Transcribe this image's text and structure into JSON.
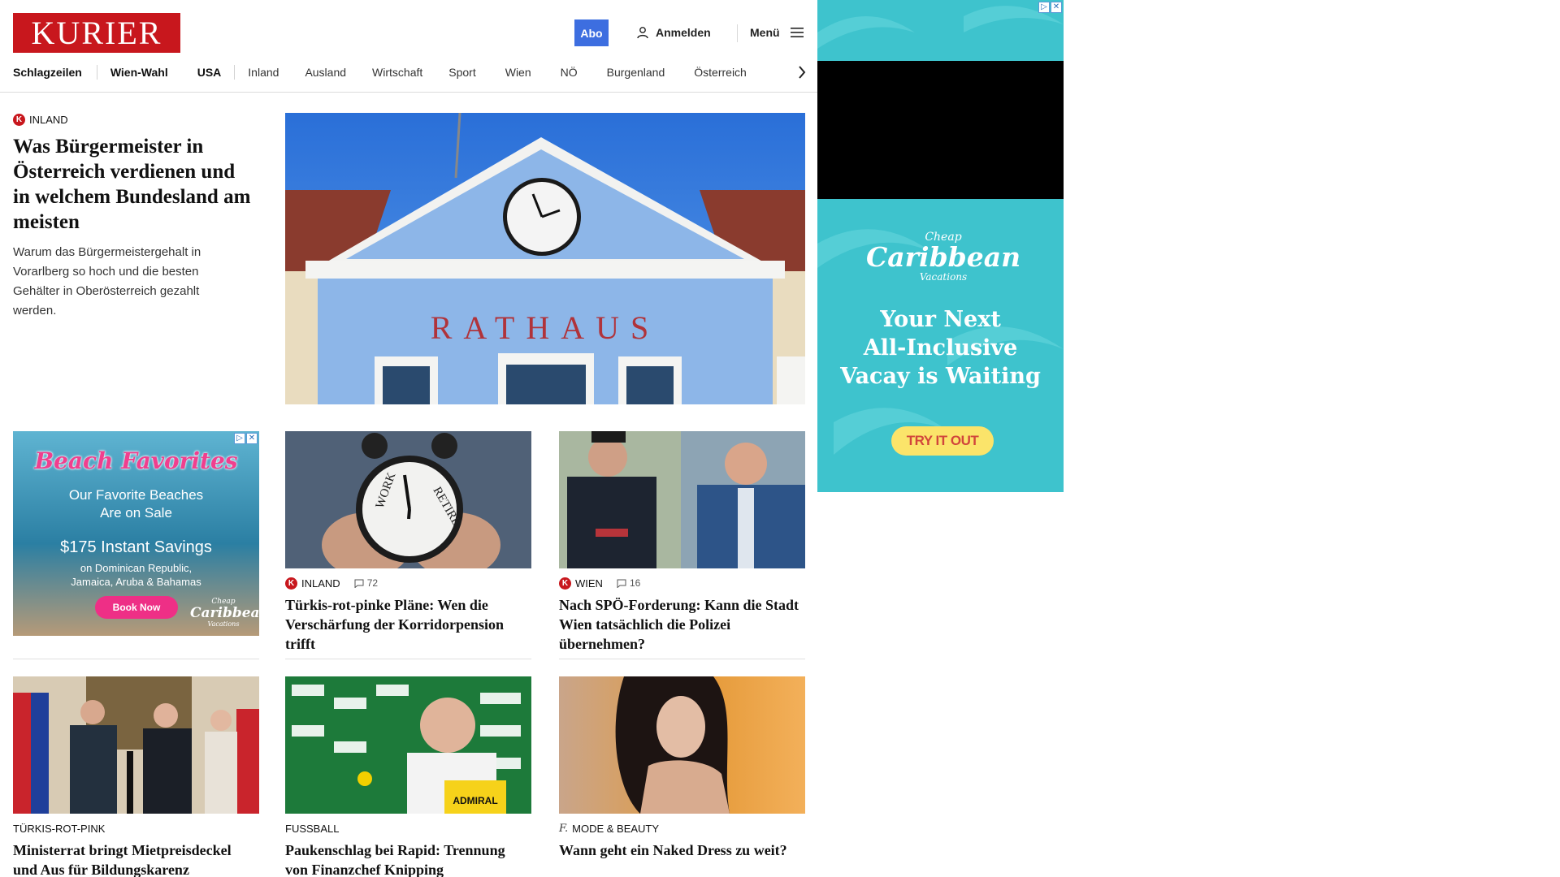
{
  "header": {
    "logo": "KURIER",
    "abo_label": "Abo",
    "login_label": "Anmelden",
    "menu_label": "Menü"
  },
  "nav": {
    "items": [
      "Schlagzeilen",
      "Wien-Wahl",
      "USA",
      "Inland",
      "Ausland",
      "Wirtschaft",
      "Sport",
      "Wien",
      "NÖ",
      "Burgenland",
      "Österreich"
    ]
  },
  "hero": {
    "kicker_badge": "K",
    "kicker": "INLAND",
    "headline": "Was Bürgermeister in Österreich verdienen und in welchem Bundesland am meisten",
    "teaser": "Warum das Bürgermeistergehalt in Vorarlberg so hoch und die besten Gehälter in Oberösterreich gezahlt werden.",
    "image_sign": "RATHAUS"
  },
  "cards": [
    {
      "kicker_badge": "K",
      "kicker": "INLAND",
      "comments": "72",
      "headline": "Türkis-rot-pinke Pläne: Wen die Verschärfung der Korridorpension trifft",
      "clock_text_left": "WORK",
      "clock_text_right": "RETIRE"
    },
    {
      "kicker_badge": "K",
      "kicker": "WIEN",
      "comments": "16",
      "headline": "Nach SPÖ-Forderung: Kann die Stadt Wien tatsächlich die Polizei übernehmen?"
    },
    {
      "kicker": "TÜRKIS-ROT-PINK",
      "headline": "Ministerrat bringt Mietpreisdeckel und Aus für Bildungskarenz"
    },
    {
      "kicker": "FUSSBALL",
      "headline": "Paukenschlag bei Rapid: Trennung von Finanzchef Knipping",
      "sponsor_text": "ADMIRAL"
    },
    {
      "kicker_badge": "f.",
      "kicker": "MODE & BEAUTY",
      "headline": "Wann geht ein Naked Dress zu weit?"
    }
  ],
  "ad_small": {
    "title": "Beach Favorites",
    "line1": "Our Favorite Beaches",
    "line2": "Are on Sale",
    "savings": "$175 Instant Savings",
    "detail1": "on Dominican Republic,",
    "detail2": "Jamaica, Aruba & Bahamas",
    "button": "Book Now",
    "brand_top": "Cheap",
    "brand_main": "Caribbean",
    "brand_bottom": "Vacations"
  },
  "ad_right": {
    "brand_top": "Cheap",
    "brand_main": "Caribbean",
    "brand_bottom": "Vacations",
    "line1": "Your Next",
    "line2": "All-Inclusive",
    "line3": "Vacay is Waiting",
    "button": "TRY IT OUT"
  },
  "colors": {
    "brand_red": "#c8171d",
    "abo_blue": "#3d6ee0",
    "ad_teal": "#3ec3cd",
    "ad_pink": "#ee2f86",
    "ad_yellow": "#fbe46a"
  }
}
